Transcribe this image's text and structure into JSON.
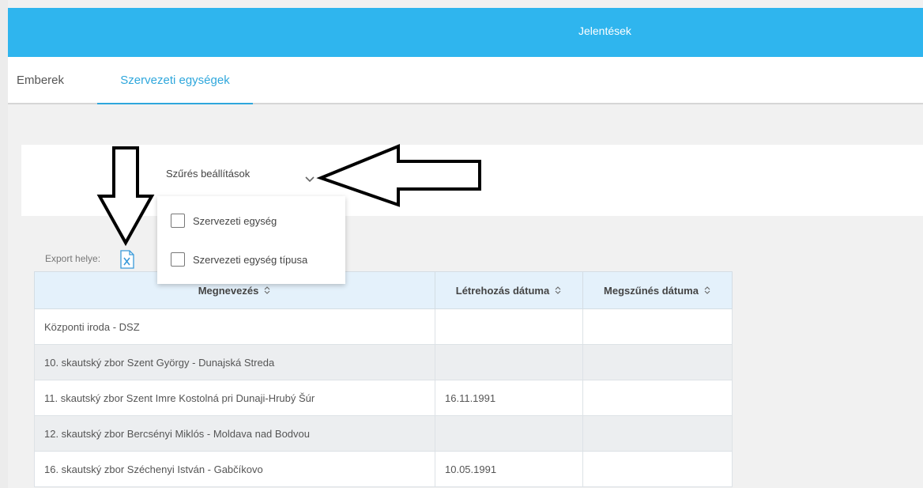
{
  "header": {
    "title": "Jelentések"
  },
  "tabs": [
    {
      "label": "Emberek",
      "active": false
    },
    {
      "label": "Szervezeti egységek",
      "active": true
    }
  ],
  "filter": {
    "toggle_label": "Szűrés beállítások",
    "options": [
      {
        "label": "Szervezeti egység",
        "checked": false
      },
      {
        "label": "Szervezeti egység típusa",
        "checked": false
      }
    ]
  },
  "export": {
    "label": "Export helye:",
    "icon": "excel-file-icon"
  },
  "table": {
    "columns": [
      "Megnevezés",
      "Létrehozás dátuma",
      "Megszűnés dátuma"
    ],
    "rows": [
      [
        "Központi iroda - DSZ",
        "",
        ""
      ],
      [
        "10. skautský zbor Szent György - Dunajská Streda",
        "",
        ""
      ],
      [
        "11. skautský zbor Szent Imre Kostolná pri Dunaji-Hrubý Šúr",
        "16.11.1991",
        ""
      ],
      [
        "12. skautský zbor Bercsényi Miklós - Moldava nad Bodvou",
        "",
        ""
      ],
      [
        "16. skautský zbor Széchenyi István - Gabčíkovo",
        "10.05.1991",
        ""
      ]
    ]
  },
  "colors": {
    "accent": "#2fb5ee",
    "active_tab": "#2fa7dc",
    "header_row": "#e4f1fb",
    "alt_row": "#eceef0"
  }
}
